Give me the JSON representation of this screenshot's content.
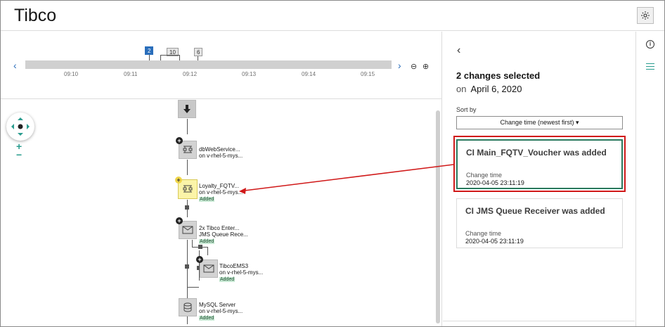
{
  "header": {
    "title": "Tibco"
  },
  "timeline": {
    "ticks": [
      "09:10",
      "09:11",
      "09:12",
      "09:13",
      "09:14",
      "09:15"
    ],
    "badges": [
      "2",
      "10",
      "6"
    ]
  },
  "map": {
    "nodes": [
      {
        "name": "dbWebService...",
        "host": "on v-rhel-5-mys...",
        "added": ""
      },
      {
        "name": "Loyalty_FQTV...",
        "host": "on v-rhel-5-mys...",
        "added": "Added"
      },
      {
        "name": "2x Tibco Enter...",
        "host": "JMS Queue Rece...",
        "added": "Added"
      },
      {
        "name": "TibcoEMS3",
        "host": "on v-rhel-5-mys...",
        "added": "Added"
      },
      {
        "name": "MySQL Server",
        "host": "on v-rhel-5-mys...",
        "added": "Added"
      }
    ]
  },
  "panel": {
    "title": "2 changes selected",
    "on_prefix": "on",
    "date": "April 6, 2020",
    "sort_label": "Sort by",
    "sort_value": "Change time (newest first)",
    "cards": [
      {
        "title": "CI Main_FQTV_Voucher was added",
        "label": "Change time",
        "value": "2020-04-05 23:11:19"
      },
      {
        "title": "CI JMS Queue Receiver was added",
        "label": "Change time",
        "value": "2020-04-05 23:11:19"
      }
    ]
  },
  "colors": {
    "accent": "#2a9d8f",
    "highlight": "#d01818",
    "selected_border": "#2a7a5e"
  }
}
